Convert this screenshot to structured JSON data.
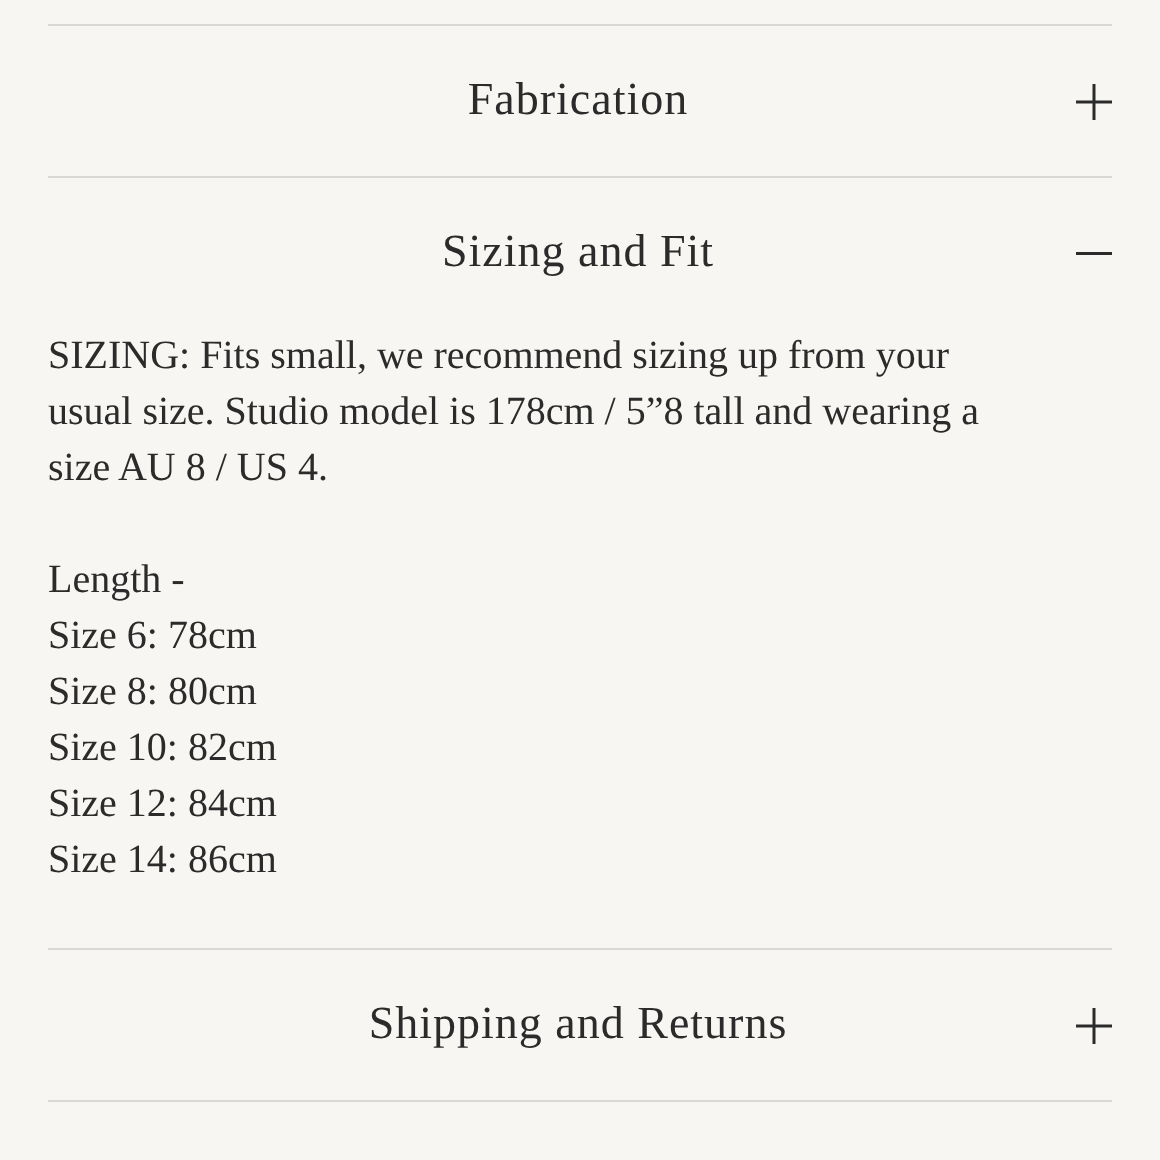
{
  "sections": [
    {
      "title": "Fabrication",
      "expanded": false
    },
    {
      "title": "Sizing and Fit",
      "expanded": true,
      "paragraphs": [
        "SIZING: Fits small, we recommend sizing up from your usual size. Studio model is 178cm / 5”8 tall and wearing a size AU 8 / US 4."
      ],
      "lines": [
        "Length -",
        "Size 6: 78cm",
        "Size 8: 80cm",
        "Size 10: 82cm",
        "Size 12: 84cm",
        "Size 14: 86cm"
      ]
    },
    {
      "title": "Shipping and Returns",
      "expanded": false
    }
  ]
}
